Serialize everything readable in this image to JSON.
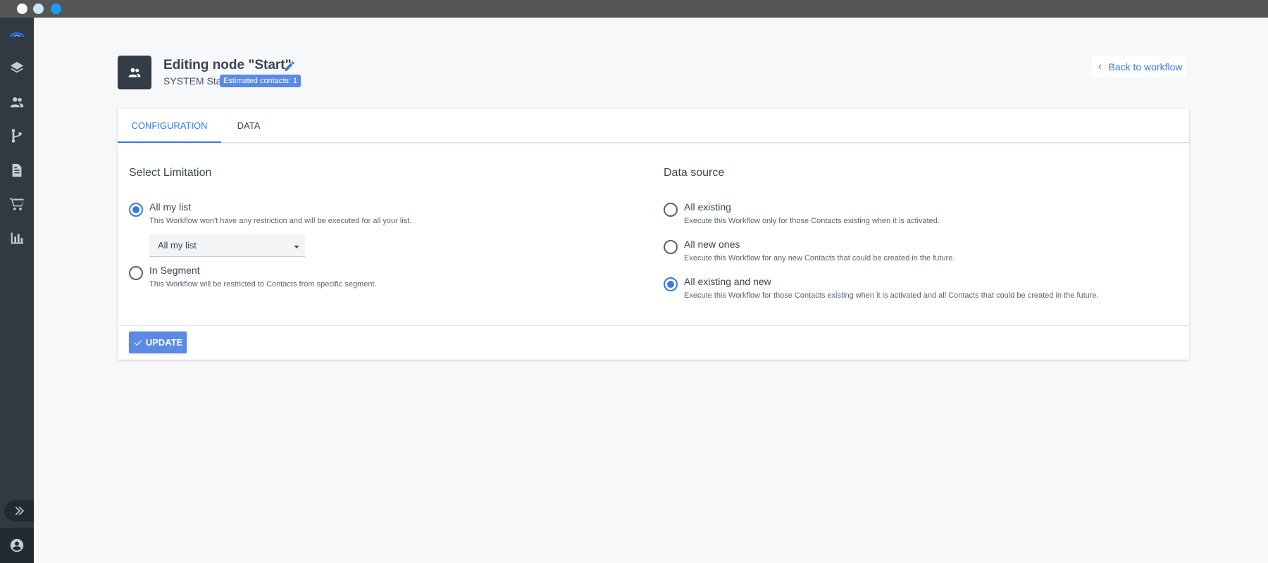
{
  "window": {
    "dots": [
      "close",
      "minimize",
      "maximize"
    ]
  },
  "sidebar": {
    "items": [
      {
        "icon": "logo-icon"
      },
      {
        "icon": "layers-icon"
      },
      {
        "icon": "contacts-icon"
      },
      {
        "icon": "workflow-icon"
      },
      {
        "icon": "document-icon"
      },
      {
        "icon": "cart-icon"
      },
      {
        "icon": "bar-chart-icon"
      }
    ],
    "expand_icon": "double-chevron-right-icon",
    "account_icon": "account-circle-icon"
  },
  "header": {
    "title": "Editing node \"Start\"",
    "subtitle": "SYSTEM Start",
    "badge": "Estimated contacts: 1",
    "back_label": "Back to workflow"
  },
  "tabs": [
    {
      "label": "CONFIGURATION",
      "active": true
    },
    {
      "label": "DATA",
      "active": false
    }
  ],
  "limitation": {
    "title": "Select Limitation",
    "options": [
      {
        "label": "All my list",
        "desc": "This Workflow won't have any restriction and will be executed for all your list.",
        "checked": true
      },
      {
        "label": "In Segment",
        "desc": "This Workflow will be restricted to Contacts from specific segment.",
        "checked": false
      }
    ],
    "select_value": "All my list"
  },
  "data_source": {
    "title": "Data source",
    "options": [
      {
        "label": "All existing",
        "desc": "Execute this Workflow only for those Contacts existing when it is activated.",
        "checked": false
      },
      {
        "label": "All new ones",
        "desc": "Execute this Workflow for any new Contacts that could be created in the future.",
        "checked": false
      },
      {
        "label": "All existing and new",
        "desc": "Execute this Workflow for those Contacts existing when it is activated and all Contacts that could be created in the future.",
        "checked": true
      }
    ]
  },
  "actions": {
    "update_label": "UPDATE"
  },
  "colors": {
    "accent": "#3a78e0",
    "sidebar": "#313a43",
    "badge": "#5b8ae6"
  }
}
